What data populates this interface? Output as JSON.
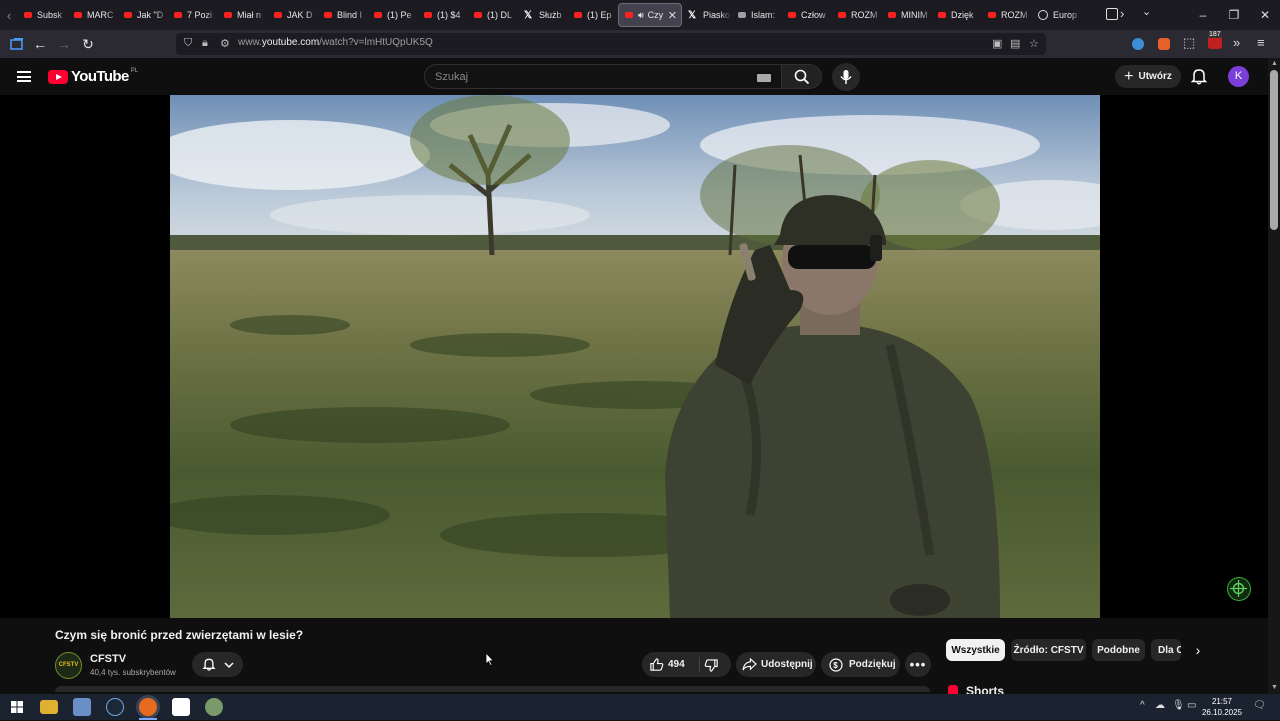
{
  "browser": {
    "tabs": [
      {
        "label": "Subsk",
        "icon": "youtube-icon"
      },
      {
        "label": "MARC",
        "icon": "youtube-icon"
      },
      {
        "label": "Jak \"D",
        "icon": "youtube-icon"
      },
      {
        "label": "7 Pozi",
        "icon": "youtube-icon"
      },
      {
        "label": "Miał n",
        "icon": "youtube-icon"
      },
      {
        "label": "JAK D",
        "icon": "youtube-icon"
      },
      {
        "label": "Blind I",
        "icon": "youtube-icon"
      },
      {
        "label": "(1) Pe",
        "icon": "youtube-icon"
      },
      {
        "label": "(1) $4",
        "icon": "youtube-icon"
      },
      {
        "label": "(1) DL",
        "icon": "youtube-icon"
      },
      {
        "label": "Służb",
        "icon": "x-icon"
      },
      {
        "label": "(1) Ep",
        "icon": "youtube-icon"
      },
      {
        "label": "Czy",
        "icon": "youtube-icon",
        "active": true
      },
      {
        "label": "Piasko",
        "icon": "x-icon"
      },
      {
        "label": "Islam:",
        "icon": "flag-icon"
      },
      {
        "label": "Człow",
        "icon": "youtube-icon"
      },
      {
        "label": "ROZM",
        "icon": "youtube-icon"
      },
      {
        "label": "MINIM",
        "icon": "youtube-icon"
      },
      {
        "label": "Dzięk",
        "icon": "youtube-icon"
      },
      {
        "label": "ROZM",
        "icon": "youtube-icon"
      },
      {
        "label": "Europ",
        "icon": "globe-icon"
      }
    ],
    "extensions_badge": "187",
    "url_prefix": "www.",
    "url_domain": "youtube.com",
    "url_path": "/watch?v=lmHtUQpUK5Q"
  },
  "youtube": {
    "logo_text": "YouTube",
    "country_code": "PL",
    "search_placeholder": "Szukaj",
    "create_label": "Utwórz",
    "avatar_letter": "K"
  },
  "video": {
    "title": "Czym się bronić przed zwierzętami w lesie?",
    "channel_name": "CFSTV",
    "channel_logo_text": "CFSTV",
    "subscribers": "40,4 tys. subskrybentów",
    "likes": "494",
    "share_label": "Udostępnij",
    "thanks_label": "Podziękuj"
  },
  "chips": [
    "Wszystkie",
    "Źródło: CFSTV",
    "Podobne",
    "Dla C"
  ],
  "shorts_heading": "Shorts",
  "taskbar": {
    "time": "21:57",
    "date": "26.10.2025"
  },
  "colors": {
    "youtube_red": "#ff0033",
    "avatar": "#7b3fd9",
    "page_bg": "#0f0f0f"
  }
}
